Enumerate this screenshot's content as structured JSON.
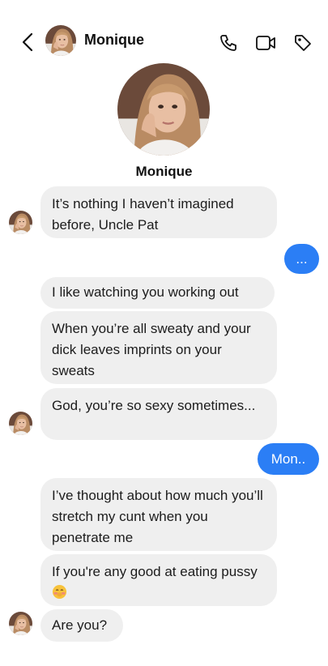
{
  "header": {
    "contact_name": "Monique",
    "icons": [
      "back-icon",
      "phone-icon",
      "video-icon",
      "tag-icon"
    ]
  },
  "profile": {
    "name": "Monique"
  },
  "messages": [
    {
      "direction": "in",
      "text": "It’s nothing I haven’t imagined before, Uncle Pat"
    },
    {
      "direction": "out",
      "text": "..."
    },
    {
      "direction": "in",
      "text": "I like watching you working out"
    },
    {
      "direction": "in",
      "text": "When you’re all sweaty and your dick leaves imprints on your sweats"
    },
    {
      "direction": "in",
      "text": "God, you’re so sexy sometimes..."
    },
    {
      "direction": "out",
      "text": "Mon.."
    },
    {
      "direction": "in",
      "text": "I’ve thought about how much you’ll stretch my cunt when you penetrate me"
    },
    {
      "direction": "in",
      "text": "If you're any good at eating pussy",
      "emoji": "blushing-face-emoji"
    },
    {
      "direction": "in",
      "text": "Are you?"
    }
  ],
  "colors": {
    "outgoing_bubble": "#2b7ef5",
    "incoming_bubble": "#efefef"
  }
}
